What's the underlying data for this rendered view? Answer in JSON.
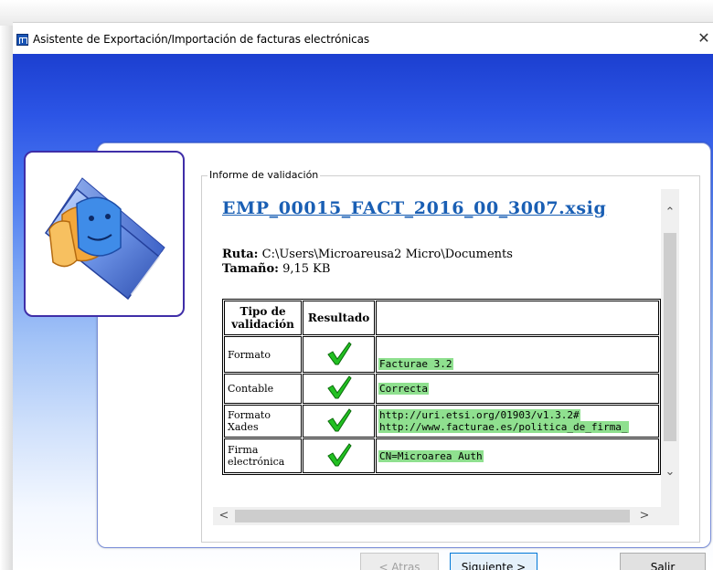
{
  "window": {
    "title": "Asistente de Exportación/Importación de facturas electrónicas",
    "close_glyph": "✕"
  },
  "report_group": {
    "legend": "Informe de validación"
  },
  "report": {
    "file_name": "EMP_00015_FACT_2016_00_3007.xsig",
    "ruta_label": "Ruta:",
    "ruta_value": "C:\\Users\\Microareusa2 Micro\\Documents",
    "size_label": "Tamaño:",
    "size_value": "9,15 KB",
    "table": {
      "headers": [
        "Tipo de validación",
        "Resultado",
        ""
      ],
      "rows": [
        {
          "tipo": "Formato",
          "resultado": "check-icon",
          "detalle": "Facturae 3.2"
        },
        {
          "tipo": "Contable",
          "resultado": "check-icon",
          "detalle": "Correcta"
        },
        {
          "tipo": "Formato Xades",
          "resultado": "check-icon",
          "detalle": "http://uri.etsi.org/01903/v1.3.2#",
          "detalle2": "http://www.facturae.es/politica_de_firma_"
        },
        {
          "tipo": "Firma electrónica",
          "resultado": "check-icon",
          "detalle": "CN=Microarea Auth"
        }
      ]
    }
  },
  "scrollbars": {
    "up": "⌃",
    "down": "⌄",
    "left": "<",
    "right": ">"
  },
  "buttons": {
    "back": "< Atras",
    "next": "Siguiente >",
    "exit": "Salir"
  },
  "colors": {
    "highlight": "#8fe08f",
    "link": "#1a5fb4",
    "check": "#22c022"
  }
}
